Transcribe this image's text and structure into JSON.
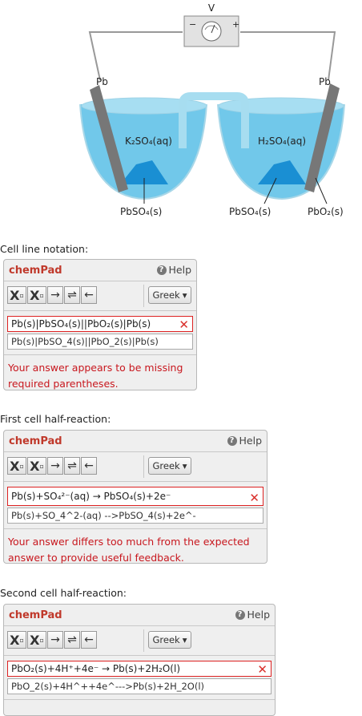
{
  "diagram": {
    "voltmeter_label": "V",
    "minus": "−",
    "plus": "+",
    "left_electrode": "Pb",
    "right_electrode": "Pb",
    "left_solution": "K₂SO₄(aq)",
    "right_solution": "H₂SO₄(aq)",
    "label_left_solid": "PbSO₄(s)",
    "label_mid_solid": "PbSO₄(s)",
    "label_right_solid": "PbO₂(s)"
  },
  "questions": [
    {
      "label": "Cell line notation:",
      "chempad": "chemPad",
      "help": "Help",
      "greek": "Greek",
      "answer_display": "Pb(s)|PbSO₄(s)||PbO₂(s)|Pb(s)",
      "answer_raw": "Pb(s)|PbSO_4(s)||PbO_2(s)|Pb(s)",
      "feedback": "Your answer appears to be missing required parentheses."
    },
    {
      "label": "First cell half-reaction:",
      "chempad": "chemPad",
      "help": "Help",
      "greek": "Greek",
      "answer_display": "Pb(s)+SO₄²⁻(aq) → PbSO₄(s)+2e⁻",
      "answer_raw": "Pb(s)+SO_4^2-(aq) -->PbSO_4(s)+2e^-",
      "feedback": "Your answer differs too much from the expected answer to provide useful feedback."
    },
    {
      "label": "Second cell half-reaction:",
      "chempad": "chemPad",
      "help": "Help",
      "greek": "Greek",
      "answer_display": "PbO₂(s)+4H⁺+4e⁻ → Pb(s)+2H₂O(l)",
      "answer_raw": "PbO_2(s)+4H^++4e^--->Pb(s)+2H_2O(l)",
      "feedback": ""
    }
  ],
  "toolbar": {
    "arrow_right": "→",
    "arrow_eq": "⇌",
    "arrow_left": "←",
    "sub_label": "X",
    "sup_label": "X"
  }
}
